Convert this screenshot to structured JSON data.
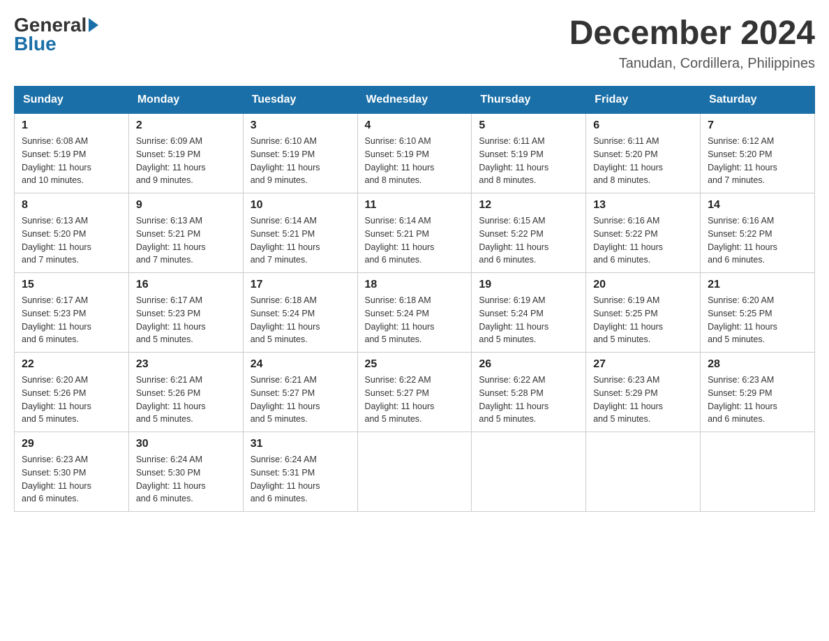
{
  "header": {
    "logo_general": "General",
    "logo_blue": "Blue",
    "month_title": "December 2024",
    "location": "Tanudan, Cordillera, Philippines"
  },
  "days_of_week": [
    "Sunday",
    "Monday",
    "Tuesday",
    "Wednesday",
    "Thursday",
    "Friday",
    "Saturday"
  ],
  "weeks": [
    [
      {
        "day": "1",
        "sunrise": "6:08 AM",
        "sunset": "5:19 PM",
        "daylight": "11 hours and 10 minutes."
      },
      {
        "day": "2",
        "sunrise": "6:09 AM",
        "sunset": "5:19 PM",
        "daylight": "11 hours and 9 minutes."
      },
      {
        "day": "3",
        "sunrise": "6:10 AM",
        "sunset": "5:19 PM",
        "daylight": "11 hours and 9 minutes."
      },
      {
        "day": "4",
        "sunrise": "6:10 AM",
        "sunset": "5:19 PM",
        "daylight": "11 hours and 8 minutes."
      },
      {
        "day": "5",
        "sunrise": "6:11 AM",
        "sunset": "5:19 PM",
        "daylight": "11 hours and 8 minutes."
      },
      {
        "day": "6",
        "sunrise": "6:11 AM",
        "sunset": "5:20 PM",
        "daylight": "11 hours and 8 minutes."
      },
      {
        "day": "7",
        "sunrise": "6:12 AM",
        "sunset": "5:20 PM",
        "daylight": "11 hours and 7 minutes."
      }
    ],
    [
      {
        "day": "8",
        "sunrise": "6:13 AM",
        "sunset": "5:20 PM",
        "daylight": "11 hours and 7 minutes."
      },
      {
        "day": "9",
        "sunrise": "6:13 AM",
        "sunset": "5:21 PM",
        "daylight": "11 hours and 7 minutes."
      },
      {
        "day": "10",
        "sunrise": "6:14 AM",
        "sunset": "5:21 PM",
        "daylight": "11 hours and 7 minutes."
      },
      {
        "day": "11",
        "sunrise": "6:14 AM",
        "sunset": "5:21 PM",
        "daylight": "11 hours and 6 minutes."
      },
      {
        "day": "12",
        "sunrise": "6:15 AM",
        "sunset": "5:22 PM",
        "daylight": "11 hours and 6 minutes."
      },
      {
        "day": "13",
        "sunrise": "6:16 AM",
        "sunset": "5:22 PM",
        "daylight": "11 hours and 6 minutes."
      },
      {
        "day": "14",
        "sunrise": "6:16 AM",
        "sunset": "5:22 PM",
        "daylight": "11 hours and 6 minutes."
      }
    ],
    [
      {
        "day": "15",
        "sunrise": "6:17 AM",
        "sunset": "5:23 PM",
        "daylight": "11 hours and 6 minutes."
      },
      {
        "day": "16",
        "sunrise": "6:17 AM",
        "sunset": "5:23 PM",
        "daylight": "11 hours and 5 minutes."
      },
      {
        "day": "17",
        "sunrise": "6:18 AM",
        "sunset": "5:24 PM",
        "daylight": "11 hours and 5 minutes."
      },
      {
        "day": "18",
        "sunrise": "6:18 AM",
        "sunset": "5:24 PM",
        "daylight": "11 hours and 5 minutes."
      },
      {
        "day": "19",
        "sunrise": "6:19 AM",
        "sunset": "5:24 PM",
        "daylight": "11 hours and 5 minutes."
      },
      {
        "day": "20",
        "sunrise": "6:19 AM",
        "sunset": "5:25 PM",
        "daylight": "11 hours and 5 minutes."
      },
      {
        "day": "21",
        "sunrise": "6:20 AM",
        "sunset": "5:25 PM",
        "daylight": "11 hours and 5 minutes."
      }
    ],
    [
      {
        "day": "22",
        "sunrise": "6:20 AM",
        "sunset": "5:26 PM",
        "daylight": "11 hours and 5 minutes."
      },
      {
        "day": "23",
        "sunrise": "6:21 AM",
        "sunset": "5:26 PM",
        "daylight": "11 hours and 5 minutes."
      },
      {
        "day": "24",
        "sunrise": "6:21 AM",
        "sunset": "5:27 PM",
        "daylight": "11 hours and 5 minutes."
      },
      {
        "day": "25",
        "sunrise": "6:22 AM",
        "sunset": "5:27 PM",
        "daylight": "11 hours and 5 minutes."
      },
      {
        "day": "26",
        "sunrise": "6:22 AM",
        "sunset": "5:28 PM",
        "daylight": "11 hours and 5 minutes."
      },
      {
        "day": "27",
        "sunrise": "6:23 AM",
        "sunset": "5:29 PM",
        "daylight": "11 hours and 5 minutes."
      },
      {
        "day": "28",
        "sunrise": "6:23 AM",
        "sunset": "5:29 PM",
        "daylight": "11 hours and 6 minutes."
      }
    ],
    [
      {
        "day": "29",
        "sunrise": "6:23 AM",
        "sunset": "5:30 PM",
        "daylight": "11 hours and 6 minutes."
      },
      {
        "day": "30",
        "sunrise": "6:24 AM",
        "sunset": "5:30 PM",
        "daylight": "11 hours and 6 minutes."
      },
      {
        "day": "31",
        "sunrise": "6:24 AM",
        "sunset": "5:31 PM",
        "daylight": "11 hours and 6 minutes."
      },
      null,
      null,
      null,
      null
    ]
  ],
  "labels": {
    "sunrise": "Sunrise:",
    "sunset": "Sunset:",
    "daylight": "Daylight:"
  }
}
